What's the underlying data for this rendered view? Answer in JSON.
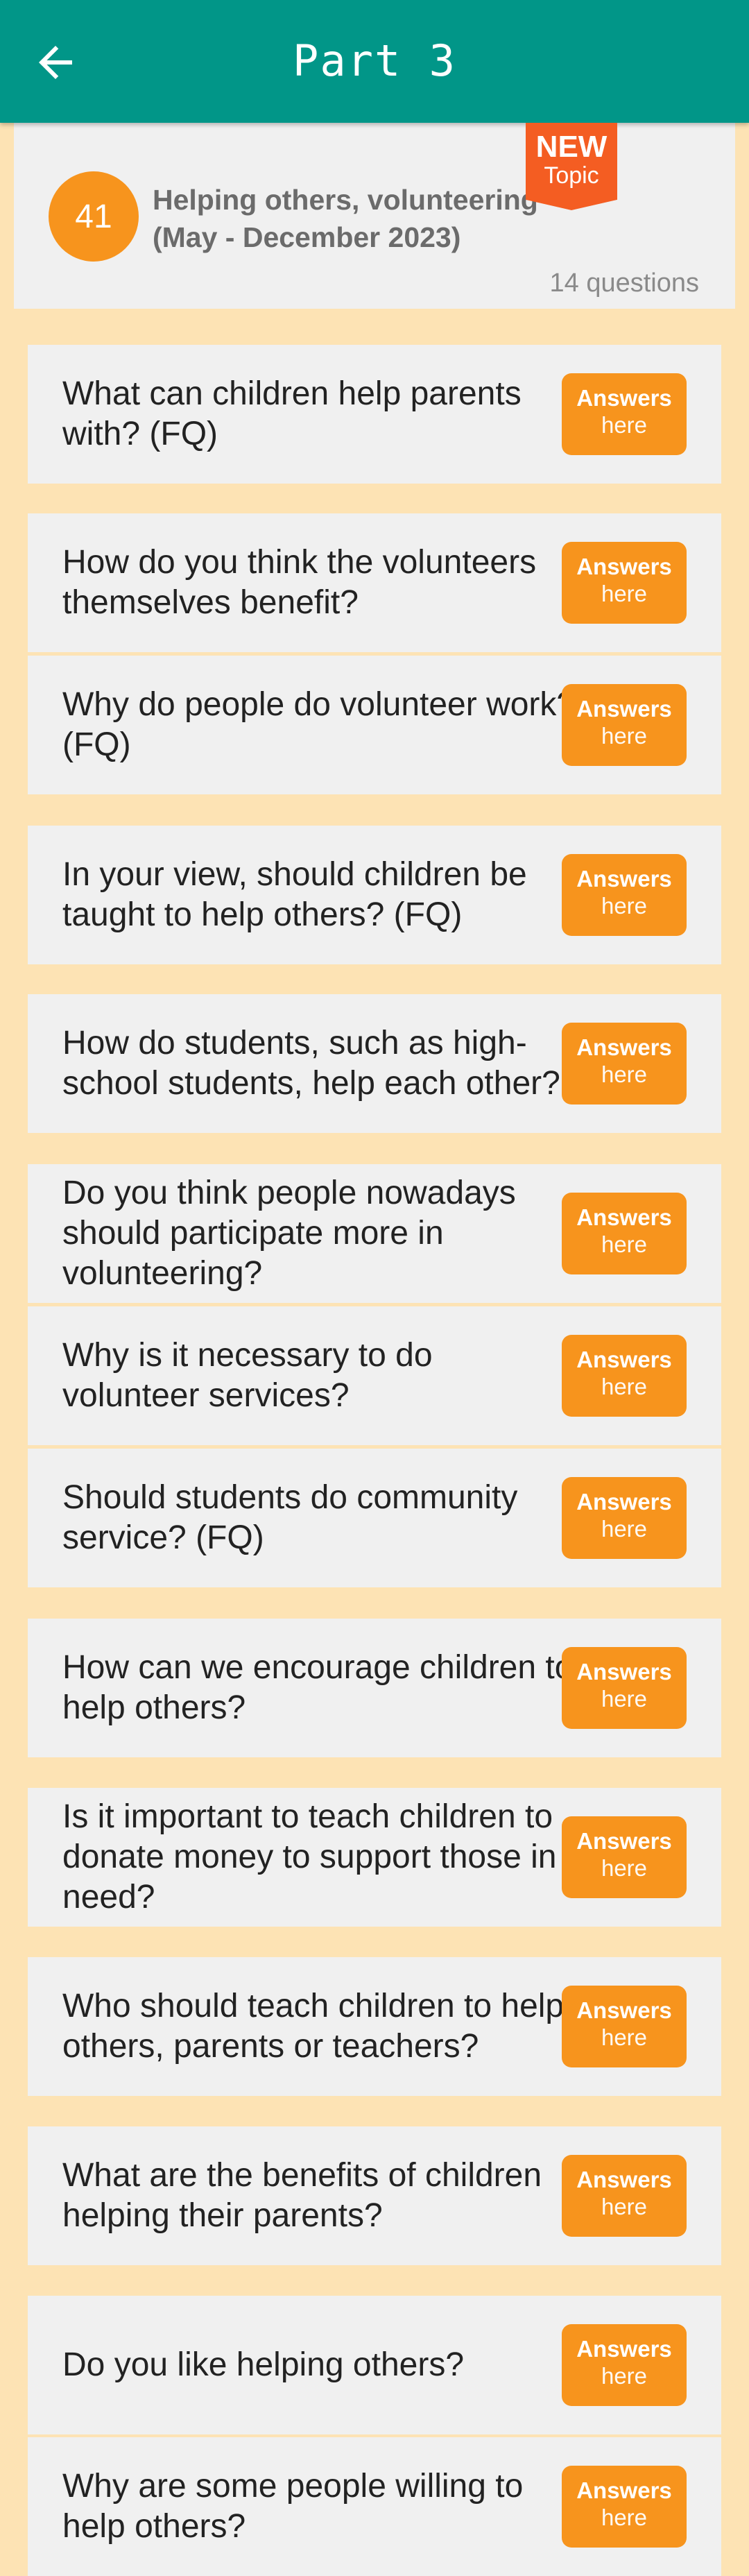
{
  "header": {
    "title": "Part 3"
  },
  "topic": {
    "number": "41",
    "title": "Helping others, volunteering (May - December 2023)",
    "count": "14 questions",
    "badge_line1": "NEW",
    "badge_line2": "Topic"
  },
  "answer_button": {
    "line1": "Answers",
    "line2": "here"
  },
  "questions": [
    "What can children help parents with? (FQ)",
    "How do you think the volunteers themselves benefit?",
    "Why do people do volunteer work? (FQ)",
    "In your view, should children be taught to help others? (FQ)",
    "How do students, such as high-school students, help each other?",
    "Do you think people nowadays should participate more in volunteering?",
    "Why is it necessary to do volunteer services?",
    "Should students do community service? (FQ)",
    "How can we encourage children to help others?",
    "Is it important to teach children to donate money to support those in need?",
    "Who should teach children to help others, parents or teachers?",
    "What are the benefits of children helping their parents?",
    "Do you like helping others?",
    "Why are some people willing to help others?"
  ],
  "colors": {
    "app_bar": "#019688",
    "background": "#fde3b4",
    "card": "#f0f0f0",
    "accent": "#f7941d",
    "badge": "#f45d22"
  }
}
